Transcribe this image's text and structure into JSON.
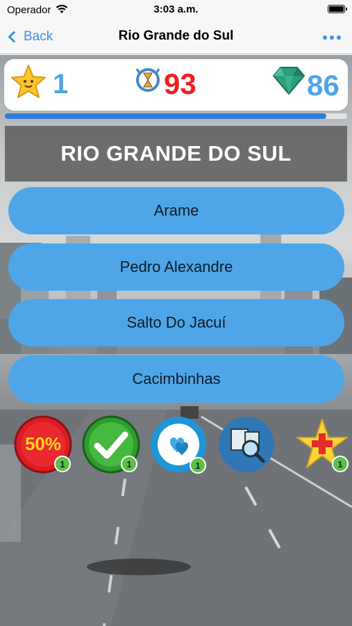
{
  "status_bar": {
    "carrier": "Operador",
    "time": "3:03 a.m."
  },
  "nav": {
    "back_label": "Back",
    "title": "Rio Grande do Sul"
  },
  "scores": {
    "stars": "1",
    "timer": "93",
    "gems": "86"
  },
  "progress": {
    "fraction": 0.94
  },
  "question": {
    "text": "RIO GRANDE DO SUL"
  },
  "answers": [
    {
      "label": "Arame"
    },
    {
      "label": "Pedro Alexandre"
    },
    {
      "label": "Salto Do Jacuí"
    },
    {
      "label": "Cacimbinhas"
    }
  ],
  "powerups": [
    {
      "name": "fifty-fifty",
      "label": "50%",
      "count": "1"
    },
    {
      "name": "correct-answer",
      "count": "1"
    },
    {
      "name": "extra-lives",
      "count": "1"
    },
    {
      "name": "research",
      "count": "1"
    },
    {
      "name": "star-bonus",
      "count": "1"
    }
  ],
  "colors": {
    "accent": "#3a8ff0",
    "answer": "#4ea6e8",
    "timer": "#ee1f1f",
    "badge": "#5dbf45"
  }
}
